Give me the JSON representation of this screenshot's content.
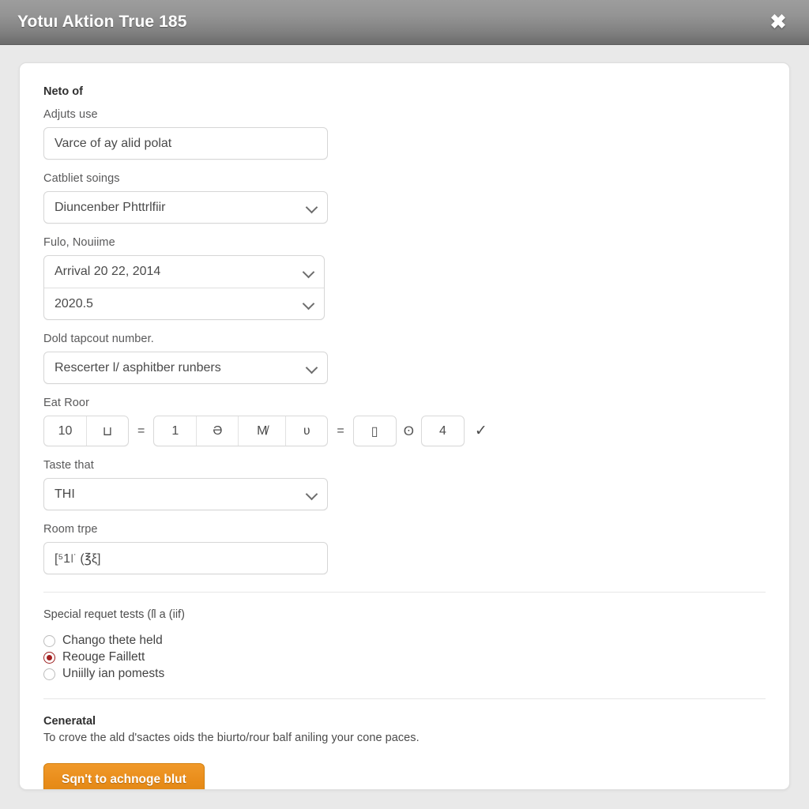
{
  "titlebar": {
    "title": "Yotuı Aktion True 185",
    "close_glyph": "✖"
  },
  "form": {
    "section_heading": "Neto of",
    "fields": {
      "adjust": {
        "label": "Adjuts use",
        "value": "Varce of ay alid polat"
      },
      "settings": {
        "label": "Catbliet soings",
        "value": "Diuncenber Phttrlfiir"
      },
      "dates": {
        "label": "Fulo, Nouiime",
        "row1": "Arrival 20 22, 2014",
        "row2": "2020.5"
      },
      "tapcount": {
        "label": "Dold tapcout number.",
        "value": "Rescerter l/ asphitber runbers"
      },
      "eat_roor": {
        "label": "Eat Roor",
        "group1": [
          "10",
          "⊔"
        ],
        "eq1": "=",
        "group2": [
          "1",
          "Ə",
          "M̸",
          "ʋ"
        ],
        "eq2": "=",
        "group3": [
          "▯"
        ],
        "between": "ʘ",
        "group4": [
          "4"
        ],
        "confirm": "✓"
      },
      "taste": {
        "label": "Taste that",
        "value": "THI"
      },
      "room_type": {
        "label": "Room trpe",
        "value": "[⁵1꜍ (℥ξ]"
      }
    },
    "special": {
      "title": "Special requet tests (ſl a (iif)",
      "options": [
        {
          "label": "Chango thete held",
          "checked": false
        },
        {
          "label": "Reouge Faillett",
          "checked": true
        },
        {
          "label": "Uniilly ian pomests",
          "checked": false
        }
      ]
    },
    "footer": {
      "heading": "Ceneratal",
      "text": "To crove the ald d'sactes oids the biurto/rour ƅalf aniling your cone paces.",
      "submit_label": "Sqn't to achnoge blut"
    }
  },
  "colors": {
    "accent_orange": "#e98d1b",
    "radio_selected": "#a52020",
    "titlebar_gray": "#8a8a8a"
  }
}
